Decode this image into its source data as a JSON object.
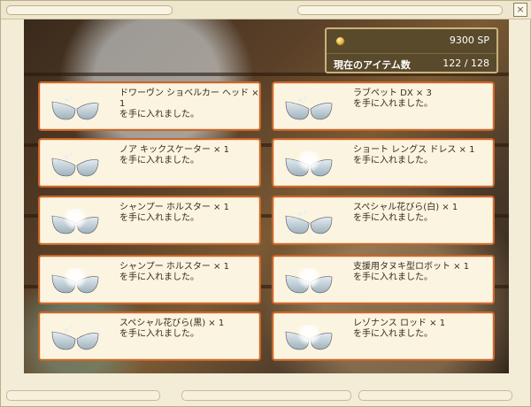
{
  "window": {
    "close_label": "×"
  },
  "status": {
    "sp_value": "9300 SP",
    "item_count_label": "現在のアイテム数",
    "item_count_value": "122 / 128"
  },
  "colors": {
    "accent_orange": "#c9662b",
    "teal": "#1f9d8e",
    "silver": "#aebdc6"
  },
  "items": [
    {
      "name": "ドワーヴン ショベルカー ヘッド × 1",
      "result": "を手に入れました。",
      "orb": "silver"
    },
    {
      "name": "ラブペット DX × 3",
      "result": "を手に入れました。",
      "orb": "teal"
    },
    {
      "name": "ノア キックスケーター × 1",
      "result": "を手に入れました。",
      "orb": "silver"
    },
    {
      "name": "ショート レングス ドレス × 1",
      "result": "を手に入れました。",
      "orb": "teal-glow"
    },
    {
      "name": "シャンプー ホルスター × 1",
      "result": "を手に入れました。",
      "orb": "teal-glow"
    },
    {
      "name": "スペシャル花びら(白) × 1",
      "result": "を手に入れました。",
      "orb": "teal"
    },
    {
      "name": "シャンプー ホルスター × 1",
      "result": "を手に入れました。",
      "orb": "teal-glow"
    },
    {
      "name": "支援用タヌキ型ロボット × 1",
      "result": "を手に入れました。",
      "orb": "silver-glow"
    },
    {
      "name": "スペシャル花びら(黒) × 1",
      "result": "を手に入れました。",
      "orb": "teal"
    },
    {
      "name": "レゾナンス ロッド × 1",
      "result": "を手に入れました。",
      "orb": "silver-glow"
    }
  ]
}
